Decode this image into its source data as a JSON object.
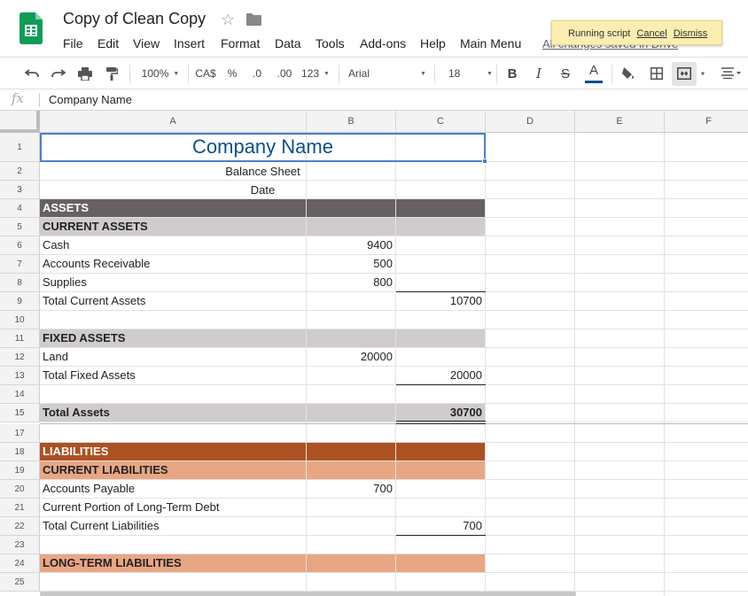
{
  "app": {
    "doc_title": "Copy of Clean Copy",
    "save_status": "All changes saved in Drive",
    "menu": [
      "File",
      "Edit",
      "View",
      "Insert",
      "Format",
      "Data",
      "Tools",
      "Add-ons",
      "Help",
      "Main Menu"
    ],
    "toast": {
      "message": "Running script",
      "cancel": "Cancel",
      "dismiss": "Dismiss",
      "bg": "#fbeeb0"
    },
    "brand_color": "#0f9d58"
  },
  "toolbar": {
    "zoom": "100%",
    "currency": "CA$",
    "percent": "%",
    "dec_decrease": ".0",
    "dec_increase": ".00",
    "more_formats": "123",
    "font": "Arial",
    "font_size": "18",
    "bold": "B",
    "italic": "I",
    "strike": "S",
    "text_color": "A",
    "text_color_value": "#0b4f8a",
    "icons": [
      "undo-icon",
      "redo-icon",
      "print-icon",
      "paint-format-icon",
      "fill-color-icon",
      "borders-icon",
      "merge-cells-icon",
      "align-icon"
    ]
  },
  "formula_bar": {
    "fx": "fx",
    "value": "Company Name"
  },
  "grid": {
    "columns": [
      "A",
      "B",
      "C",
      "D",
      "E",
      "F"
    ],
    "row_numbers": [
      "1",
      "2",
      "3",
      "4",
      "5",
      "6",
      "7",
      "8",
      "9",
      "10",
      "11",
      "12",
      "13",
      "14",
      "15",
      "17",
      "18",
      "19",
      "20",
      "21",
      "22",
      "23",
      "24",
      "25"
    ],
    "title": "Company Name",
    "subtitle": "Balance Sheet",
    "date": "Date",
    "assets_header": "ASSETS",
    "current_assets": "CURRENT ASSETS",
    "cash": "Cash",
    "cash_value": "9400",
    "ar": "Accounts Receivable",
    "ar_value": "500",
    "supplies": "Supplies",
    "supplies_value": "800",
    "total_current_assets": "Total Current Assets",
    "total_current_assets_value": "10700",
    "fixed_assets": "FIXED ASSETS",
    "land": "Land",
    "land_value": "20000",
    "total_fixed_assets": "Total Fixed Assets",
    "total_fixed_assets_value": "20000",
    "total_assets": "Total Assets",
    "total_assets_value": "30700",
    "liabilities_header": "LIABILITIES",
    "current_liabilities": "CURRENT LIABILITIES",
    "accounts_payable": "Accounts Payable",
    "accounts_payable_value": "700",
    "current_portion_ltd": "Current Portion of Long-Term Debt",
    "total_current_liabilities": "Total Current Liabilities",
    "total_current_liabilities_value": "700",
    "long_term_liabilities": "LONG-TERM LIABILITIES",
    "colors": {
      "assets_dark": "#666061",
      "assets_light": "#d0cccd",
      "liab_dark": "#ad5122",
      "liab_light": "#e8a684",
      "title_blue": "#0b4f8a"
    }
  }
}
